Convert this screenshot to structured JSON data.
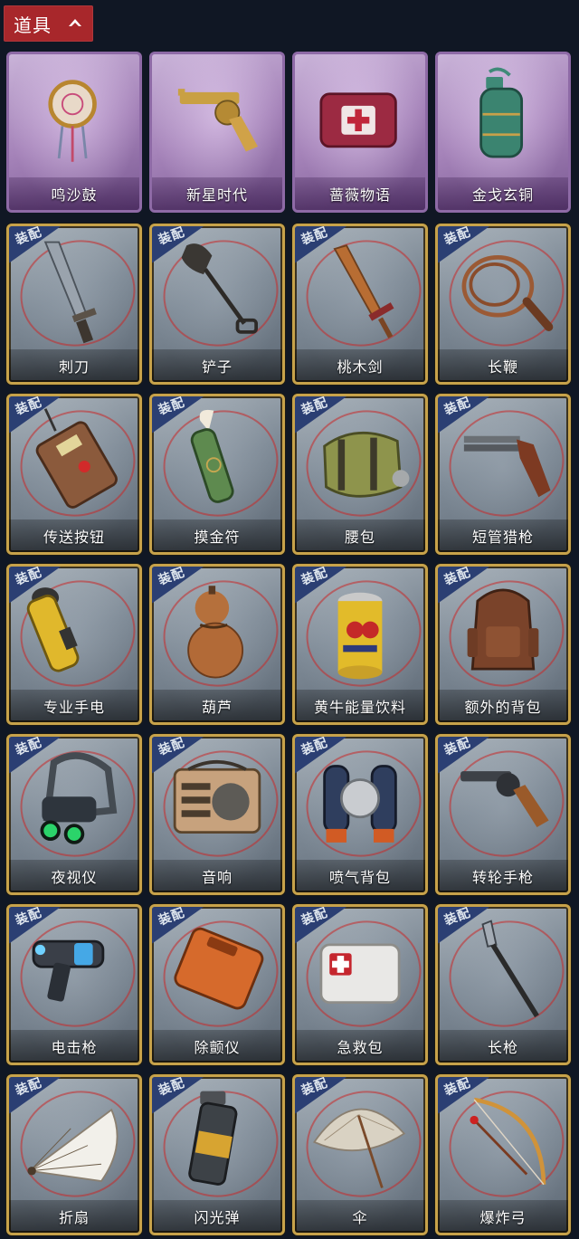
{
  "header": {
    "title": "道具"
  },
  "badge_label": "装配",
  "items": [
    {
      "name": "鸣沙鼓",
      "icon": "dreamcatcher-drum-icon",
      "type": "special"
    },
    {
      "name": "新星时代",
      "icon": "golden-revolver-icon",
      "type": "special"
    },
    {
      "name": "蔷薇物语",
      "icon": "rose-medkit-icon",
      "type": "special"
    },
    {
      "name": "金戈玄铜",
      "icon": "bronze-grenade-icon",
      "type": "special"
    },
    {
      "name": "刺刀",
      "icon": "bayonet-icon",
      "type": "common"
    },
    {
      "name": "铲子",
      "icon": "shovel-icon",
      "type": "common"
    },
    {
      "name": "桃木剑",
      "icon": "peachwood-sword-icon",
      "type": "common"
    },
    {
      "name": "长鞭",
      "icon": "whip-icon",
      "type": "common"
    },
    {
      "name": "传送按钮",
      "icon": "teleport-remote-icon",
      "type": "common"
    },
    {
      "name": "摸金符",
      "icon": "talisman-tooth-icon",
      "type": "common"
    },
    {
      "name": "腰包",
      "icon": "waist-bag-icon",
      "type": "common"
    },
    {
      "name": "短管猎枪",
      "icon": "sawed-off-shotgun-icon",
      "type": "common"
    },
    {
      "name": "专业手电",
      "icon": "flashlight-icon",
      "type": "common"
    },
    {
      "name": "葫芦",
      "icon": "gourd-icon",
      "type": "common"
    },
    {
      "name": "黄牛能量饮料",
      "icon": "energy-drink-can-icon",
      "type": "common"
    },
    {
      "name": "额外的背包",
      "icon": "backpack-icon",
      "type": "common"
    },
    {
      "name": "夜视仪",
      "icon": "night-vision-goggles-icon",
      "type": "common"
    },
    {
      "name": "音响",
      "icon": "radio-speaker-icon",
      "type": "common"
    },
    {
      "name": "喷气背包",
      "icon": "jetpack-icon",
      "type": "common"
    },
    {
      "name": "转轮手枪",
      "icon": "revolver-icon",
      "type": "common"
    },
    {
      "name": "电击枪",
      "icon": "stun-gun-icon",
      "type": "common"
    },
    {
      "name": "除颤仪",
      "icon": "defibrillator-icon",
      "type": "common"
    },
    {
      "name": "急救包",
      "icon": "first-aid-kit-icon",
      "type": "common"
    },
    {
      "name": "长枪",
      "icon": "spear-icon",
      "type": "common"
    },
    {
      "name": "折扇",
      "icon": "folding-fan-icon",
      "type": "common"
    },
    {
      "name": "闪光弹",
      "icon": "flashbang-icon",
      "type": "common"
    },
    {
      "name": "伞",
      "icon": "umbrella-icon",
      "type": "common"
    },
    {
      "name": "爆炸弓",
      "icon": "explosive-bow-icon",
      "type": "common"
    }
  ],
  "colors": {
    "background": "#101724",
    "header_red": "#a8272b",
    "gold_frame": "#c7a24a",
    "special_purple": "#a583b9",
    "badge_blue": "#2b3f73"
  }
}
